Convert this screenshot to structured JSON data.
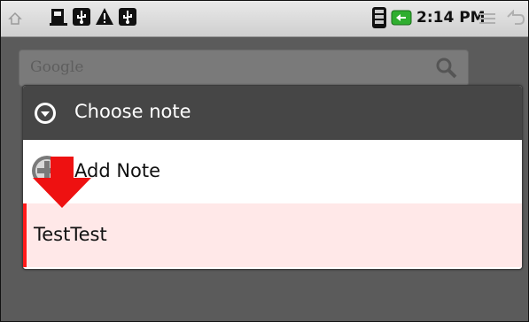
{
  "status_bar": {
    "time": "2:14 PM",
    "notification_icons": [
      "sd-card-icon",
      "usb-icon",
      "warning-icon",
      "usb-icon"
    ]
  },
  "home_screen": {
    "search_placeholder": "Google"
  },
  "dialog": {
    "title": "Choose note",
    "items": [
      {
        "label": "Add Note",
        "icon": "add-note-icon"
      },
      {
        "label": "TestTest",
        "selected": true
      }
    ]
  },
  "colors": {
    "dialog_header": "#464646",
    "selected_row": "#ffe8e8",
    "accent_red": "#ff1a1a",
    "battery_green": "#2fae2f"
  }
}
